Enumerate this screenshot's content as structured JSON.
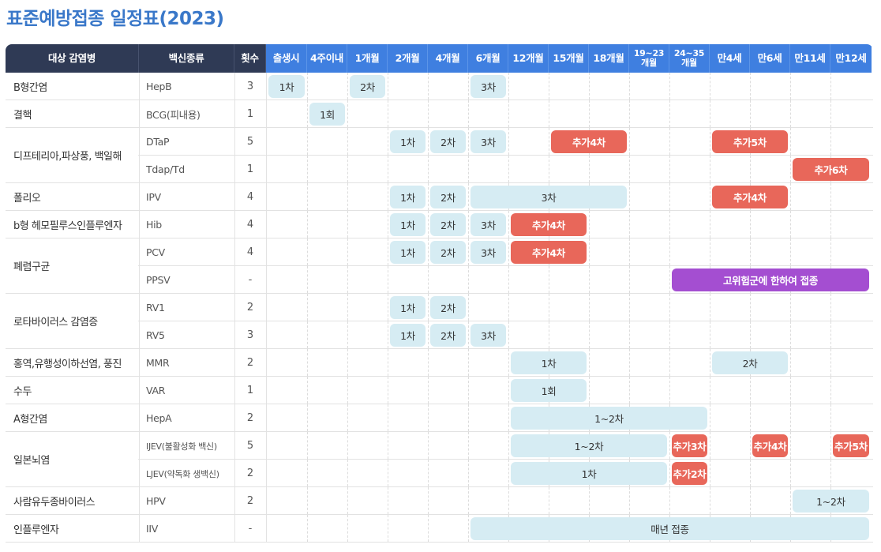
{
  "title": "표준예방접종 일정표(2023)",
  "header": {
    "disease": "대상 감염병",
    "vaccine": "백신종류",
    "count": "횟수",
    "periods": [
      "출생시",
      "4주이내",
      "1개월",
      "2개월",
      "4개월",
      "6개월",
      "12개월",
      "15개월",
      "18개월",
      "19~23\n개월",
      "24~35\n개월",
      "만4세",
      "만6세",
      "만11세",
      "만12세"
    ]
  },
  "colors": {
    "primary_pill": "#d6ecf3",
    "booster_pill": "#e8675a",
    "special_pill": "#a44ed1",
    "header_dark": "#2f3a55",
    "header_blue": "#3f7fe0",
    "title": "#3a78c9"
  },
  "diseases": [
    {
      "name": "B형간염",
      "rows": 1
    },
    {
      "name": "결핵",
      "rows": 1
    },
    {
      "name": "디프테리아,파상풍, 백일해",
      "rows": 2
    },
    {
      "name": "폴리오",
      "rows": 1
    },
    {
      "name": "b형 헤모필루스인플루엔자",
      "rows": 1
    },
    {
      "name": "폐렴구균",
      "rows": 2
    },
    {
      "name": "로타바이러스 감염증",
      "rows": 2
    },
    {
      "name": "홍역,유행성이하선염, 풍진",
      "rows": 1
    },
    {
      "name": "수두",
      "rows": 1
    },
    {
      "name": "A형간염",
      "rows": 1
    },
    {
      "name": "일본뇌염",
      "rows": 2
    },
    {
      "name": "사람유두종바이러스",
      "rows": 1
    },
    {
      "name": "인플루엔자",
      "rows": 1
    }
  ],
  "rows": [
    {
      "vaccine": "HepB",
      "count": "3",
      "doses": [
        {
          "label": "1차",
          "start": 0,
          "span": 1,
          "kind": "primary"
        },
        {
          "label": "2차",
          "start": 2,
          "span": 1,
          "kind": "primary"
        },
        {
          "label": "3차",
          "start": 5,
          "span": 1,
          "kind": "primary"
        }
      ]
    },
    {
      "vaccine": "BCG(피내용)",
      "count": "1",
      "doses": [
        {
          "label": "1회",
          "start": 1,
          "span": 1,
          "kind": "primary"
        }
      ]
    },
    {
      "vaccine": "DTaP",
      "count": "5",
      "doses": [
        {
          "label": "1차",
          "start": 3,
          "span": 1,
          "kind": "primary"
        },
        {
          "label": "2차",
          "start": 4,
          "span": 1,
          "kind": "primary"
        },
        {
          "label": "3차",
          "start": 5,
          "span": 1,
          "kind": "primary"
        },
        {
          "label": "추가4차",
          "start": 7,
          "span": 2,
          "kind": "booster"
        },
        {
          "label": "추가5차",
          "start": 11,
          "span": 2,
          "kind": "booster"
        }
      ]
    },
    {
      "vaccine": "Tdap/Td",
      "count": "1",
      "doses": [
        {
          "label": "추가6차",
          "start": 13,
          "span": 2,
          "kind": "booster"
        }
      ]
    },
    {
      "vaccine": "IPV",
      "count": "4",
      "doses": [
        {
          "label": "1차",
          "start": 3,
          "span": 1,
          "kind": "primary"
        },
        {
          "label": "2차",
          "start": 4,
          "span": 1,
          "kind": "primary"
        },
        {
          "label": "3차",
          "start": 5,
          "span": 4,
          "kind": "primary"
        },
        {
          "label": "추가4차",
          "start": 11,
          "span": 2,
          "kind": "booster"
        }
      ]
    },
    {
      "vaccine": "Hib",
      "count": "4",
      "doses": [
        {
          "label": "1차",
          "start": 3,
          "span": 1,
          "kind": "primary"
        },
        {
          "label": "2차",
          "start": 4,
          "span": 1,
          "kind": "primary"
        },
        {
          "label": "3차",
          "start": 5,
          "span": 1,
          "kind": "primary"
        },
        {
          "label": "추가4차",
          "start": 6,
          "span": 2,
          "kind": "booster"
        }
      ]
    },
    {
      "vaccine": "PCV",
      "count": "4",
      "doses": [
        {
          "label": "1차",
          "start": 3,
          "span": 1,
          "kind": "primary"
        },
        {
          "label": "2차",
          "start": 4,
          "span": 1,
          "kind": "primary"
        },
        {
          "label": "3차",
          "start": 5,
          "span": 1,
          "kind": "primary"
        },
        {
          "label": "추가4차",
          "start": 6,
          "span": 2,
          "kind": "booster"
        }
      ]
    },
    {
      "vaccine": "PPSV",
      "count": "-",
      "doses": [
        {
          "label": "고위험군에 한하여 접종",
          "start": 10,
          "span": 5,
          "kind": "special"
        }
      ]
    },
    {
      "vaccine": "RV1",
      "count": "2",
      "doses": [
        {
          "label": "1차",
          "start": 3,
          "span": 1,
          "kind": "primary"
        },
        {
          "label": "2차",
          "start": 4,
          "span": 1,
          "kind": "primary"
        }
      ]
    },
    {
      "vaccine": "RV5",
      "count": "3",
      "doses": [
        {
          "label": "1차",
          "start": 3,
          "span": 1,
          "kind": "primary"
        },
        {
          "label": "2차",
          "start": 4,
          "span": 1,
          "kind": "primary"
        },
        {
          "label": "3차",
          "start": 5,
          "span": 1,
          "kind": "primary"
        }
      ]
    },
    {
      "vaccine": "MMR",
      "count": "2",
      "doses": [
        {
          "label": "1차",
          "start": 6,
          "span": 2,
          "kind": "primary"
        },
        {
          "label": "2차",
          "start": 11,
          "span": 2,
          "kind": "primary"
        }
      ]
    },
    {
      "vaccine": "VAR",
      "count": "1",
      "doses": [
        {
          "label": "1회",
          "start": 6,
          "span": 2,
          "kind": "primary"
        }
      ]
    },
    {
      "vaccine": "HepA",
      "count": "2",
      "doses": [
        {
          "label": "1~2차",
          "start": 6,
          "span": 5,
          "kind": "primary"
        }
      ]
    },
    {
      "vaccine": "IJEV(불활성화 백신)",
      "count": "5",
      "doses": [
        {
          "label": "1~2차",
          "start": 6,
          "span": 4,
          "kind": "primary"
        },
        {
          "label": "추가3차",
          "start": 10,
          "span": 1,
          "kind": "booster"
        },
        {
          "label": "추가4차",
          "start": 12,
          "span": 1,
          "kind": "booster"
        },
        {
          "label": "추가5차",
          "start": 14,
          "span": 1,
          "kind": "booster"
        }
      ]
    },
    {
      "vaccine": "LJEV(약독화 생백신)",
      "count": "2",
      "doses": [
        {
          "label": "1차",
          "start": 6,
          "span": 4,
          "kind": "primary"
        },
        {
          "label": "추가2차",
          "start": 10,
          "span": 1,
          "kind": "booster"
        }
      ]
    },
    {
      "vaccine": "HPV",
      "count": "2",
      "doses": [
        {
          "label": "1~2차",
          "start": 13,
          "span": 2,
          "kind": "primary"
        }
      ]
    },
    {
      "vaccine": "IIV",
      "count": "-",
      "doses": [
        {
          "label": "매년 접종",
          "start": 5,
          "span": 10,
          "kind": "primary"
        }
      ]
    }
  ]
}
